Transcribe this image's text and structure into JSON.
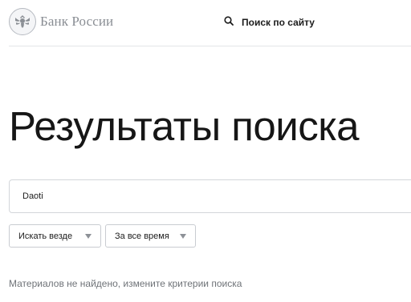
{
  "header": {
    "logo_text": "Банк России",
    "site_search_label": "Поиск по сайту"
  },
  "main": {
    "title": "Результаты поиска",
    "search": {
      "value": "Daoti"
    },
    "filters": [
      {
        "label": "Искать везде"
      },
      {
        "label": "За все время"
      }
    ],
    "status_message": "Материалов не найдено, измените критерии поиска"
  },
  "colors": {
    "title_text": "#161616",
    "muted_text": "#6f7378",
    "logo_text": "#8a8e94",
    "border": "#d3d6da"
  },
  "icons": {
    "logo": "bank-of-russia-emblem-icon",
    "site_search": "search-icon",
    "filter_arrow": "caret-down-icon"
  }
}
